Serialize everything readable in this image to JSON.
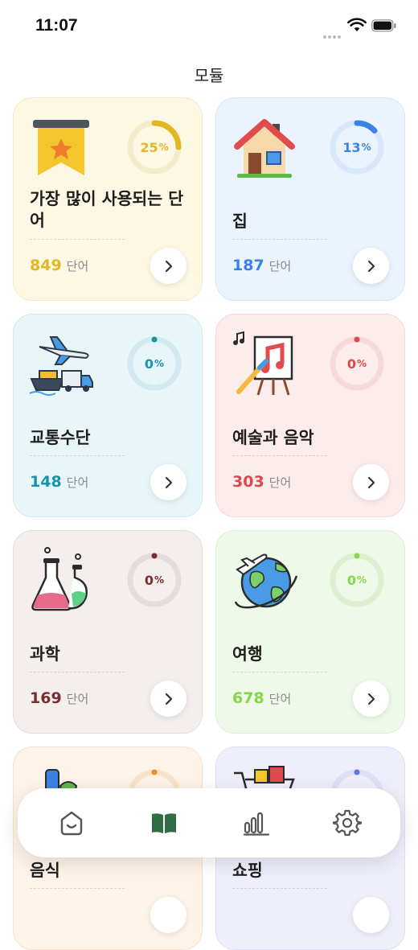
{
  "status_bar": {
    "time": "11:07"
  },
  "header": {
    "title": "모듈"
  },
  "modules": [
    {
      "title": "가장 많이 사용되는 단어",
      "count": "849",
      "unit": "단어",
      "progress": "25",
      "percent_sign": "%",
      "accent": "#e2b722",
      "bg": "#fdf8e4",
      "border": "#f3ebc5",
      "track": "#f5eccb",
      "icon": "bookmark-star-icon"
    },
    {
      "title": "집",
      "count": "187",
      "unit": "단어",
      "progress": "13",
      "percent_sign": "%",
      "accent": "#3c82e6",
      "bg": "#eaf3fe",
      "border": "#d6e6fb",
      "track": "#d8e7fb",
      "icon": "house-icon"
    },
    {
      "title": "교통수단",
      "count": "148",
      "unit": "단어",
      "progress": "0",
      "percent_sign": "%",
      "accent": "#1793ad",
      "bg": "#e9f6f9",
      "border": "#cfe8ef",
      "track": "#d1eaf0",
      "icon": "transport-icon"
    },
    {
      "title": "예술과 음악",
      "count": "303",
      "unit": "단어",
      "progress": "0",
      "percent_sign": "%",
      "accent": "#e04848",
      "bg": "#fdecec",
      "border": "#f6d7d7",
      "track": "#f8d9d9",
      "icon": "art-music-icon"
    },
    {
      "title": "과학",
      "count": "169",
      "unit": "단어",
      "progress": "0",
      "percent_sign": "%",
      "accent": "#7a2e2e",
      "bg": "#f4eeed",
      "border": "#e7dcdb",
      "track": "#e6dcdb",
      "icon": "flask-icon"
    },
    {
      "title": "여행",
      "count": "678",
      "unit": "단어",
      "progress": "0",
      "percent_sign": "%",
      "accent": "#86d64a",
      "bg": "#eff9e9",
      "border": "#dcefd0",
      "track": "#ddf0d1",
      "icon": "globe-plane-icon"
    },
    {
      "title": "음식",
      "count": "",
      "unit": "",
      "progress": "",
      "percent_sign": "",
      "accent": "#f08a24",
      "bg": "#fdf3e8",
      "border": "#f6e2cd",
      "track": "#f8e3cc",
      "icon": "food-icon"
    },
    {
      "title": "쇼핑",
      "count": "",
      "unit": "",
      "progress": "",
      "percent_sign": "",
      "accent": "#6377d8",
      "bg": "#eeeffb",
      "border": "#dcdff5",
      "track": "#dde0f6",
      "icon": "shopping-cart-icon"
    }
  ],
  "tab_bar": {
    "items": [
      {
        "name": "home",
        "icon": "home-face-icon",
        "active": false
      },
      {
        "name": "modules",
        "icon": "book-icon",
        "active": true
      },
      {
        "name": "stats",
        "icon": "bar-chart-icon",
        "active": false
      },
      {
        "name": "settings",
        "icon": "gear-icon",
        "active": false
      }
    ]
  }
}
